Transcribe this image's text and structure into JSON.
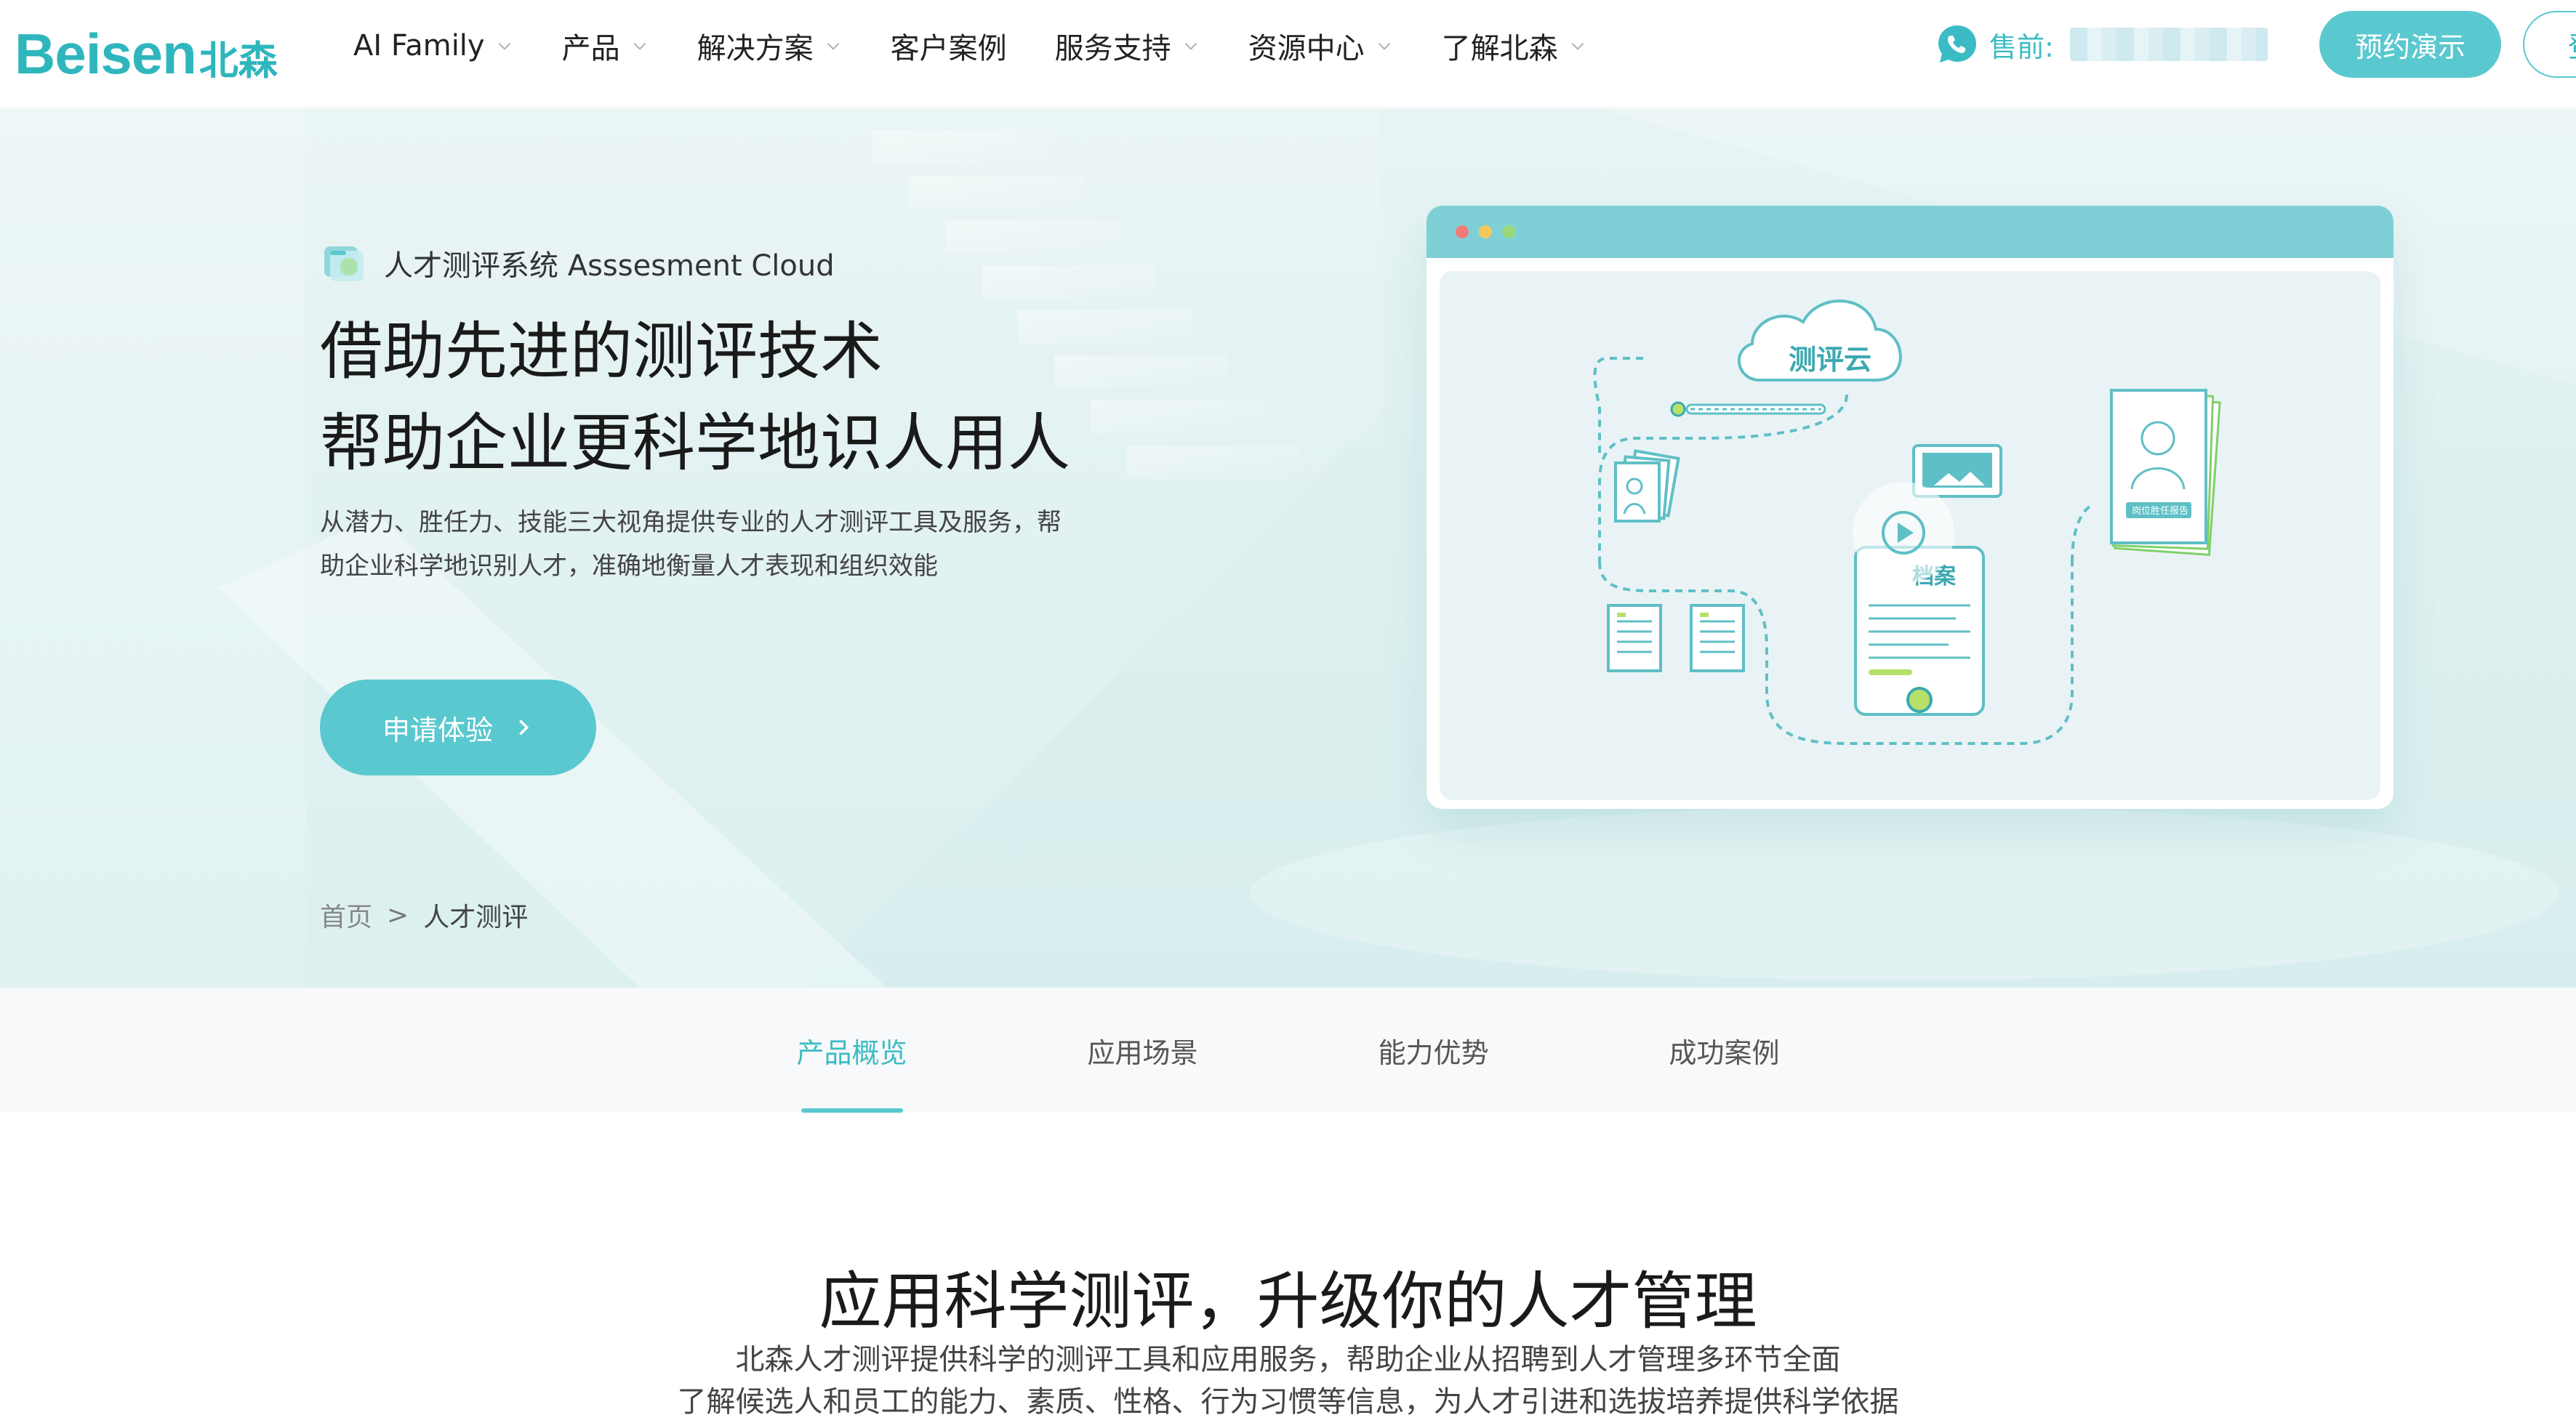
{
  "header": {
    "logo_en": "Beisen",
    "logo_cn": "北森",
    "nav": [
      {
        "label": "AI Family",
        "dropdown": true
      },
      {
        "label": "产品",
        "dropdown": true
      },
      {
        "label": "解决方案",
        "dropdown": true
      },
      {
        "label": "客户案例",
        "dropdown": false
      },
      {
        "label": "服务支持",
        "dropdown": true
      },
      {
        "label": "资源中心",
        "dropdown": true
      },
      {
        "label": "了解北森",
        "dropdown": true
      }
    ],
    "presales_label": "售前:",
    "demo_button": "预约演示",
    "login_button": "登"
  },
  "hero": {
    "product_name": "人才测评系统 Asssesment Cloud",
    "title_line1": "借助先进的测评技术",
    "title_line2": "帮助企业更科学地识人用人",
    "desc_line1": "从潜力、胜任力、技能三大视角提供专业的人才测评工具及服务，帮",
    "desc_line2": "助企业科学地识别人才，准确地衡量人才表现和组织效能",
    "apply_button": "申请体验",
    "illustration": {
      "cloud_label": "测评云",
      "archive_label": "档案",
      "report_label": "岗位胜任报告"
    }
  },
  "breadcrumb": {
    "home": "首页",
    "separator": ">",
    "current": "人才测评"
  },
  "tabs": [
    {
      "label": "产品概览",
      "active": true
    },
    {
      "label": "应用场景",
      "active": false
    },
    {
      "label": "能力优势",
      "active": false
    },
    {
      "label": "成功案例",
      "active": false
    }
  ],
  "section": {
    "title": "应用科学测评，升级你的人才管理",
    "desc_line1": "北森人才测评提供科学的测评工具和应用服务，帮助企业从招聘到人才管理多环节全面",
    "desc_line2": "了解候选人和员工的能力、素质、性格、行为习惯等信息，为人才引进和选拔培养提供科学依据"
  },
  "colors": {
    "brand": "#2fb6bd",
    "button": "#5ac8cf",
    "hero_bg": "#dff0f0"
  }
}
